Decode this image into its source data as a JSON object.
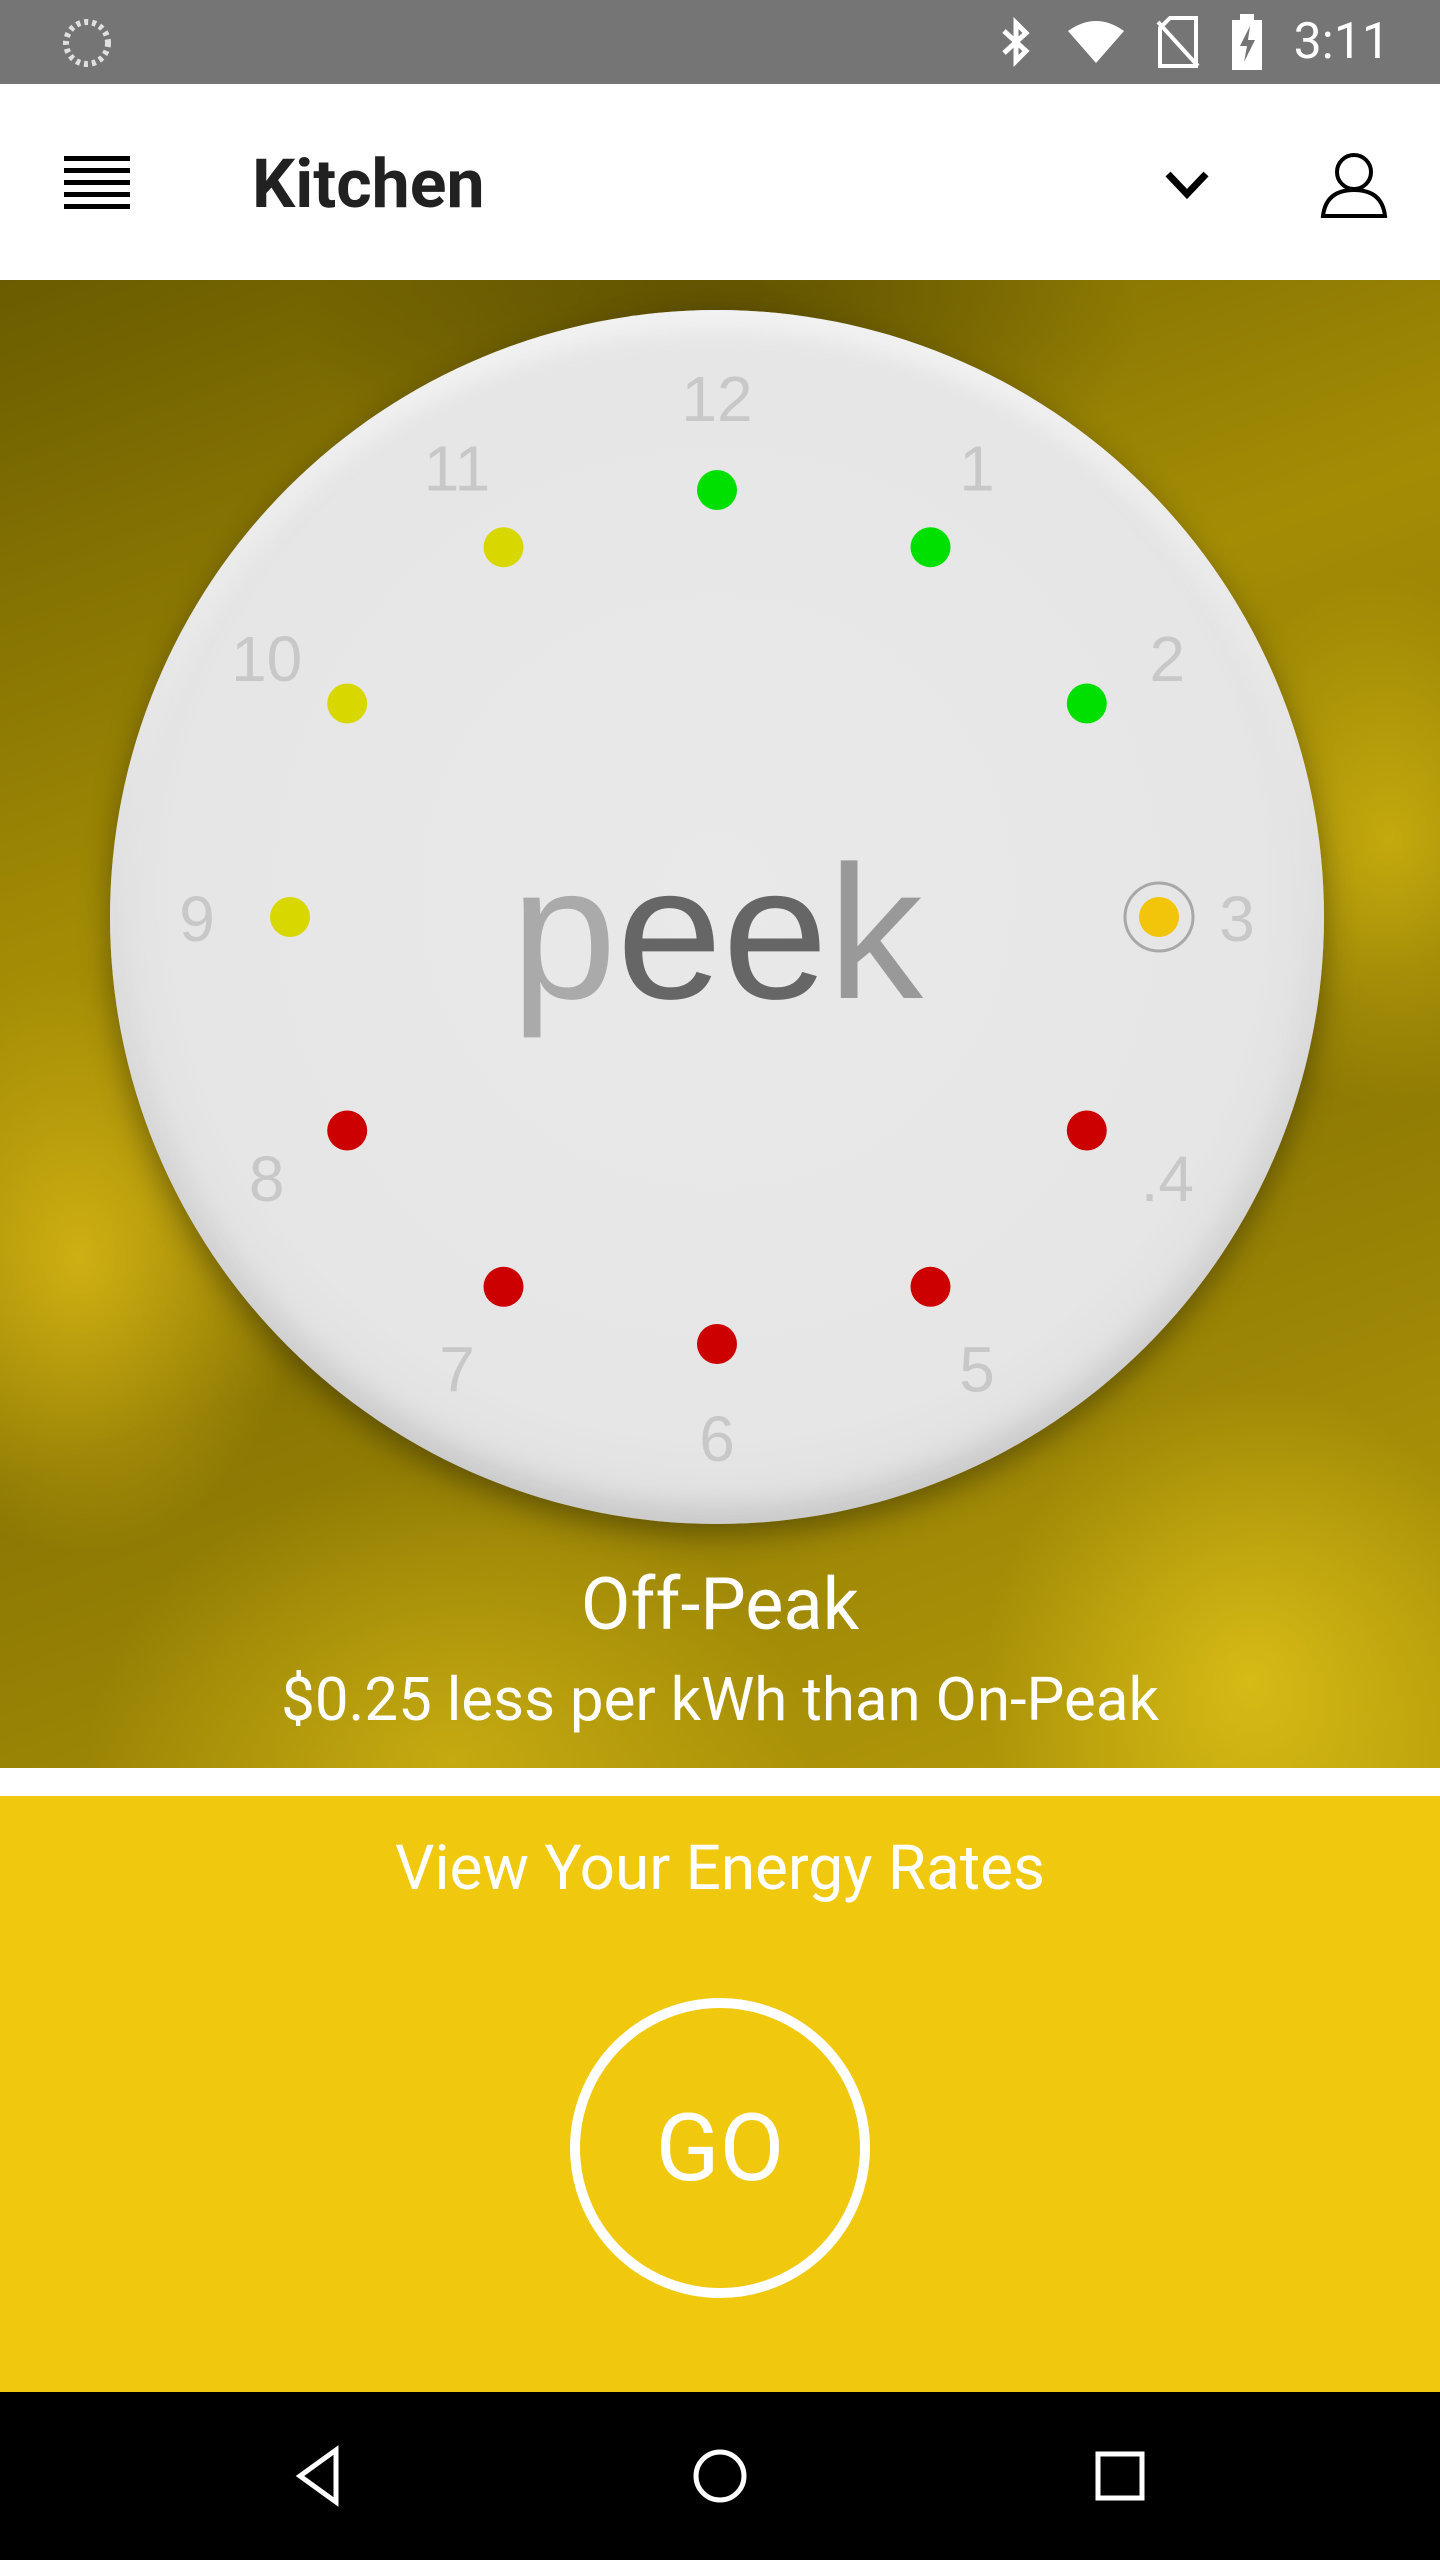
{
  "status_bar": {
    "time": "3:11",
    "icons": [
      "loading-icon",
      "bluetooth-icon",
      "wifi-icon",
      "no-sim-icon",
      "battery-charging-icon"
    ]
  },
  "app_bar": {
    "title": "Kitchen",
    "icons": [
      "menu-icon",
      "chevron-down-icon",
      "user-icon"
    ]
  },
  "dial": {
    "logo_text": "peek",
    "hour_labels": [
      "12",
      "1",
      "2",
      "3",
      ".4",
      "5",
      "6",
      "7",
      "8",
      "9",
      "10",
      "11"
    ],
    "hour_dots": [
      {
        "hour": "12",
        "color": "#00e000"
      },
      {
        "hour": "1",
        "color": "#00e000"
      },
      {
        "hour": "2",
        "color": "#00e000"
      },
      {
        "hour": "3",
        "color": "#f2c40a",
        "current": true
      },
      {
        "hour": "4",
        "color": "#cc0000"
      },
      {
        "hour": "5",
        "color": "#cc0000"
      },
      {
        "hour": "6",
        "color": "#cc0000"
      },
      {
        "hour": "7",
        "color": "#cc0000"
      },
      {
        "hour": "8",
        "color": "#cc0000"
      },
      {
        "hour": "9",
        "color": "#d8d800"
      },
      {
        "hour": "10",
        "color": "#d8d800"
      },
      {
        "hour": "11",
        "color": "#d8d800"
      }
    ]
  },
  "rate_status": {
    "period": "Off-Peak",
    "detail": "$0.25 less per kWh than On-Peak"
  },
  "rates_panel": {
    "title": "View Your Energy Rates",
    "go_label": "GO"
  },
  "colors": {
    "status_bar": "#757575",
    "accent_yellow": "#f0c80e",
    "dot_green": "#00e000",
    "dot_yellow": "#d8d800",
    "dot_red": "#cc0000"
  }
}
